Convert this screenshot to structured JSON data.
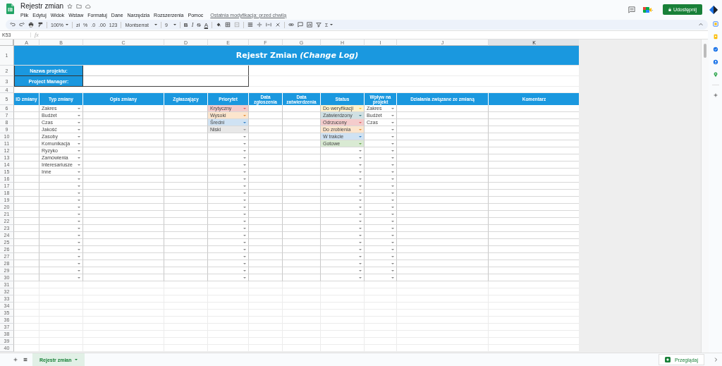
{
  "document": {
    "title": "Rejestr zmian",
    "last_edit": "Ostatnia modyfikacja: przed chwilą"
  },
  "menu": [
    "Plik",
    "Edytuj",
    "Widok",
    "Wstaw",
    "Formatuj",
    "Dane",
    "Narzędzia",
    "Rozszerzenia",
    "Pomoc"
  ],
  "share_button": "Udostępnij",
  "toolbar": {
    "zoom": "100%",
    "number_formats": [
      "zł",
      "%",
      ".0",
      ".00",
      "123"
    ],
    "font": "Montserrat",
    "font_size": "9",
    "text_styles": [
      "B",
      "I",
      "S",
      "A"
    ],
    "functions": "Σ"
  },
  "formula_bar": {
    "cell_ref": "K53",
    "fx": "fx"
  },
  "columns": [
    {
      "letter": "A",
      "selected": false,
      "kind": "text"
    },
    {
      "letter": "B",
      "selected": false,
      "kind": "dropdown"
    },
    {
      "letter": "C",
      "selected": false,
      "kind": "text"
    },
    {
      "letter": "D",
      "selected": false,
      "kind": "text"
    },
    {
      "letter": "E",
      "selected": false,
      "kind": "dropdown"
    },
    {
      "letter": "F",
      "selected": false,
      "kind": "text"
    },
    {
      "letter": "G",
      "selected": false,
      "kind": "text"
    },
    {
      "letter": "H",
      "selected": false,
      "kind": "dropdown"
    },
    {
      "letter": "I",
      "selected": false,
      "kind": "dropdown"
    },
    {
      "letter": "J",
      "selected": false,
      "kind": "text"
    },
    {
      "letter": "K",
      "selected": true,
      "kind": "text"
    }
  ],
  "row_numbers": [
    "1",
    "2",
    "3",
    "4",
    "5",
    "6",
    "7",
    "8",
    "9",
    "10",
    "11",
    "12",
    "13",
    "14",
    "15",
    "16",
    "17",
    "18",
    "19",
    "20",
    "21",
    "22",
    "23",
    "24",
    "25",
    "26",
    "27",
    "28",
    "29",
    "30",
    "31",
    "32",
    "33",
    "34",
    "35",
    "36",
    "37",
    "38",
    "39",
    "40"
  ],
  "sheet_title": "Rejestr Zmian *(Change Log)*",
  "project_fields": [
    "Nazwa projektu:",
    "Project Manager:"
  ],
  "table": {
    "headers": [
      "ID zmiany",
      "Typ zmiany",
      "Opis zmiany",
      "Zgłaszający",
      "Priorytet",
      "Data zgłoszenia",
      "Data zatwierdzenia",
      "Status",
      "Wpływ na projekt",
      "Działania związane ze zmianą",
      "Komentarz"
    ],
    "rows": [
      {
        "B": "Zakres",
        "E": {
          "label": "Krytyczny",
          "color": "#f4cccc"
        },
        "H": {
          "label": "Do weryfikacji",
          "color": "#fff2cc"
        },
        "I": "Zakres"
      },
      {
        "B": "Budżet",
        "E": {
          "label": "Wysoki",
          "color": "#fce5cd"
        },
        "H": {
          "label": "Zatwierdzony",
          "color": "#d0e0e3"
        },
        "I": "Budżet"
      },
      {
        "B": "Czas",
        "E": {
          "label": "Średni",
          "color": "#cfe2f3"
        },
        "H": {
          "label": "Odrzucony",
          "color": "#f4cccc"
        },
        "I": "Czas"
      },
      {
        "B": "Jakość",
        "E": {
          "label": "Niski",
          "color": "#e8e8e8"
        },
        "H": {
          "label": "Do zrobienia",
          "color": "#fce5cd"
        }
      },
      {
        "B": "Zasoby",
        "H": {
          "label": "W trakcie",
          "color": "#cfe2f3"
        }
      },
      {
        "B": "Komunikacja",
        "H": {
          "label": "Gotowe",
          "color": "#d9ead3"
        }
      },
      {
        "B": "Ryzyko"
      },
      {
        "B": "Zamówienia"
      },
      {
        "B": "Interesariusze"
      },
      {
        "B": "Inne"
      },
      {},
      {},
      {},
      {},
      {},
      {},
      {},
      {},
      {},
      {},
      {},
      {},
      {},
      {},
      {}
    ]
  },
  "sheet_tabs": [
    {
      "label": "Rejestr zmian",
      "selected": true
    }
  ],
  "explore_button": "Przeglądaj"
}
